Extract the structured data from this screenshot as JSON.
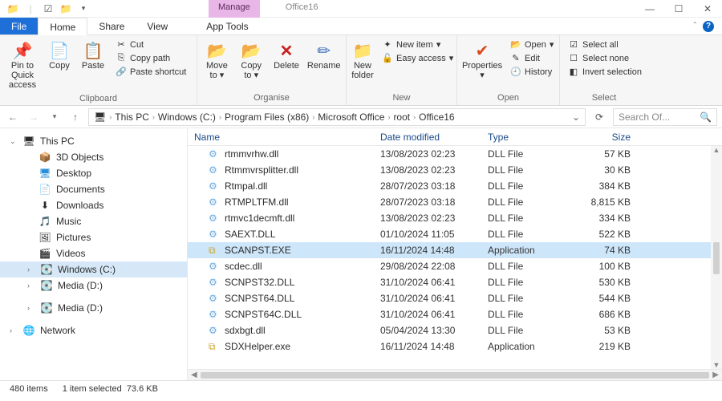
{
  "window": {
    "manage_tab": "Manage",
    "apptools_tab": "App Tools",
    "title": "Office16"
  },
  "ribbon_tabs": {
    "file": "File",
    "home": "Home",
    "share": "Share",
    "view": "View"
  },
  "ribbon": {
    "clipboard": {
      "label": "Clipboard",
      "pin": "Pin to Quick access",
      "copy": "Copy",
      "paste": "Paste",
      "cut": "Cut",
      "copy_path": "Copy path",
      "paste_shortcut": "Paste shortcut"
    },
    "organise": {
      "label": "Organise",
      "move_to": "Move to",
      "copy_to": "Copy to",
      "delete": "Delete",
      "rename": "Rename"
    },
    "new": {
      "label": "New",
      "new_folder": "New folder",
      "new_item": "New item",
      "easy_access": "Easy access"
    },
    "open": {
      "label": "Open",
      "properties": "Properties",
      "open": "Open",
      "edit": "Edit",
      "history": "History"
    },
    "select": {
      "label": "Select",
      "select_all": "Select all",
      "select_none": "Select none",
      "invert": "Invert selection"
    }
  },
  "breadcrumbs": [
    "This PC",
    "Windows (C:)",
    "Program Files (x86)",
    "Microsoft Office",
    "root",
    "Office16"
  ],
  "search_placeholder": "Search Of...",
  "nav": {
    "this_pc": "This PC",
    "objects3d": "3D Objects",
    "desktop": "Desktop",
    "documents": "Documents",
    "downloads": "Downloads",
    "music": "Music",
    "pictures": "Pictures",
    "videos": "Videos",
    "windows_c": "Windows (C:)",
    "media_d1": "Media (D:)",
    "media_d2": "Media (D:)",
    "network": "Network"
  },
  "columns": {
    "name": "Name",
    "date": "Date modified",
    "type": "Type",
    "size": "Size"
  },
  "files": [
    {
      "name": "rtmmvrhw.dll",
      "date": "13/08/2023 02:23",
      "type": "DLL File",
      "size": "57 KB",
      "icon": "dll"
    },
    {
      "name": "Rtmmvrsplitter.dll",
      "date": "13/08/2023 02:23",
      "type": "DLL File",
      "size": "30 KB",
      "icon": "dll"
    },
    {
      "name": "Rtmpal.dll",
      "date": "28/07/2023 03:18",
      "type": "DLL File",
      "size": "384 KB",
      "icon": "dll"
    },
    {
      "name": "RTMPLTFM.dll",
      "date": "28/07/2023 03:18",
      "type": "DLL File",
      "size": "8,815 KB",
      "icon": "dll"
    },
    {
      "name": "rtmvc1decmft.dll",
      "date": "13/08/2023 02:23",
      "type": "DLL File",
      "size": "334 KB",
      "icon": "dll"
    },
    {
      "name": "SAEXT.DLL",
      "date": "01/10/2024 11:05",
      "type": "DLL File",
      "size": "522 KB",
      "icon": "dll"
    },
    {
      "name": "SCANPST.EXE",
      "date": "16/11/2024 14:48",
      "type": "Application",
      "size": "74 KB",
      "icon": "exe",
      "selected": true
    },
    {
      "name": "scdec.dll",
      "date": "29/08/2024 22:08",
      "type": "DLL File",
      "size": "100 KB",
      "icon": "dll"
    },
    {
      "name": "SCNPST32.DLL",
      "date": "31/10/2024 06:41",
      "type": "DLL File",
      "size": "530 KB",
      "icon": "dll"
    },
    {
      "name": "SCNPST64.DLL",
      "date": "31/10/2024 06:41",
      "type": "DLL File",
      "size": "544 KB",
      "icon": "dll"
    },
    {
      "name": "SCNPST64C.DLL",
      "date": "31/10/2024 06:41",
      "type": "DLL File",
      "size": "686 KB",
      "icon": "dll"
    },
    {
      "name": "sdxbgt.dll",
      "date": "05/04/2024 13:30",
      "type": "DLL File",
      "size": "53 KB",
      "icon": "dll"
    },
    {
      "name": "SDXHelper.exe",
      "date": "16/11/2024 14:48",
      "type": "Application",
      "size": "219 KB",
      "icon": "exe"
    }
  ],
  "status": {
    "items": "480 items",
    "selected": "1 item selected",
    "size": "73.6 KB"
  }
}
